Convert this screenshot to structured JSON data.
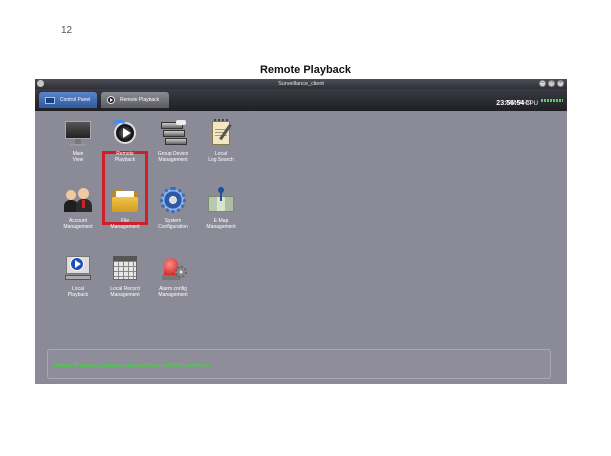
{
  "page_number": "12",
  "doc_title": "Remote Playback",
  "window": {
    "title": "Surveillance_client",
    "controls": [
      "minimize-icon",
      "maximize-icon",
      "close-icon"
    ]
  },
  "tabs": [
    {
      "label": "Control Panel",
      "icon": "monitor-icon",
      "active": true
    },
    {
      "label": "Remote Playback",
      "icon": "play-icon",
      "active": false
    }
  ],
  "clock": {
    "time": "23:56:54",
    "date": "2016-01-20",
    "cpu_label": "CPU"
  },
  "items": [
    {
      "line1": "Main",
      "line2": "View",
      "icon": "monitor-icon"
    },
    {
      "line1": "Remote",
      "line2": "Playback",
      "icon": "remote-playback-icon",
      "selected": true
    },
    {
      "line1": "Group Device",
      "line2": "Management",
      "icon": "group-device-icon"
    },
    {
      "line1": "Local",
      "line2": "Log Search",
      "icon": "notepad-icon"
    },
    {
      "line1": "Account",
      "line2": "Management",
      "icon": "users-icon"
    },
    {
      "line1": "File",
      "line2": "Management",
      "icon": "folder-icon"
    },
    {
      "line1": "System",
      "line2": "Configuration",
      "icon": "gear-icon"
    },
    {
      "line1": "E-Map",
      "line2": "Management",
      "icon": "map-icon"
    },
    {
      "line1": "Local",
      "line2": "Playback",
      "icon": "local-playback-icon"
    },
    {
      "line1": "Local Record",
      "line2": "Management",
      "icon": "calendar-icon"
    },
    {
      "line1": "Alarm config",
      "line2": "Management",
      "icon": "alarm-icon"
    }
  ],
  "status": {
    "text": "Remote Playback: Search and playback files from DVR hard drive.",
    "color": "#3fd43f"
  },
  "colors": {
    "selection_frame": "#d21e26",
    "active_tab": "#2f5aa0"
  }
}
